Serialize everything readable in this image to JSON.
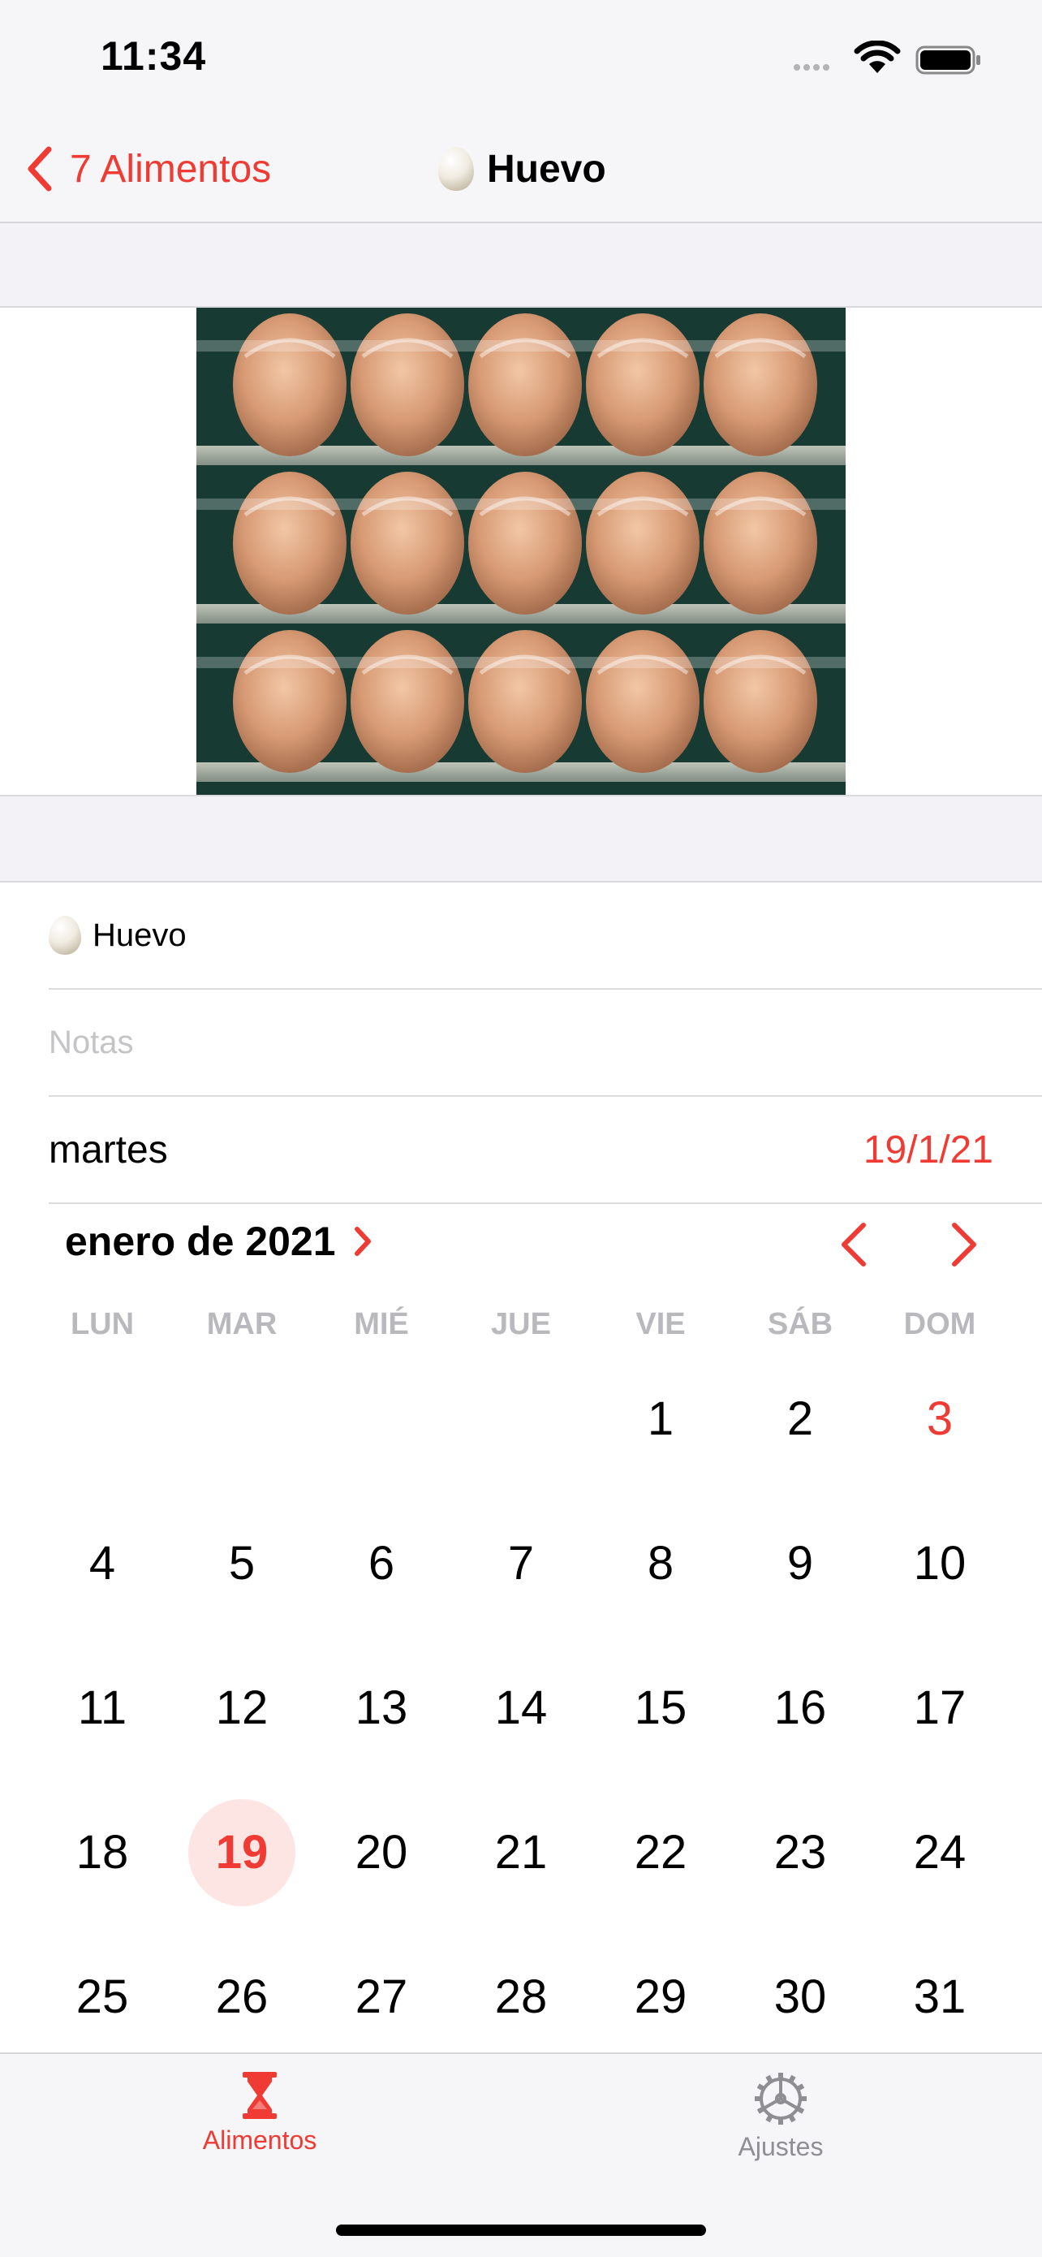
{
  "status": {
    "time": "11:34"
  },
  "nav": {
    "back_label": "7 Alimentos",
    "title": "Huevo"
  },
  "form": {
    "name": "Huevo",
    "notes_placeholder": "Notas",
    "weekday": "martes",
    "date_value": "19/1/21"
  },
  "calendar": {
    "month_label": "enero de 2021",
    "weekdays": [
      "LUN",
      "MAR",
      "MIÉ",
      "JUE",
      "VIE",
      "SÁB",
      "DOM"
    ],
    "first_weekday_index": 4,
    "days_visible": 31,
    "selected_day": 19,
    "today_day": 3
  },
  "tabs": [
    {
      "label": "Alimentos",
      "icon": "hourglass-icon",
      "active": true
    },
    {
      "label": "Ajustes",
      "icon": "gear-icon",
      "active": false
    }
  ],
  "colors": {
    "accent": "#ef3b33",
    "selected_bg": "#fde5e4",
    "inactive": "#8e8e93"
  }
}
